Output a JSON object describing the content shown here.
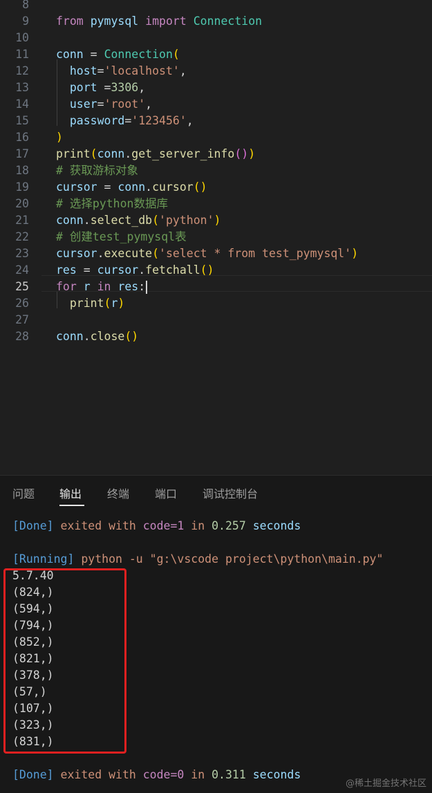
{
  "editor": {
    "lines": [
      {
        "num": "8",
        "segs": []
      },
      {
        "num": "9",
        "segs": [
          [
            "kw",
            "from"
          ],
          [
            "op",
            " "
          ],
          [
            "var",
            "pymysql"
          ],
          [
            "op",
            " "
          ],
          [
            "kw",
            "import"
          ],
          [
            "op",
            " "
          ],
          [
            "cls",
            "Connection"
          ]
        ]
      },
      {
        "num": "10",
        "segs": []
      },
      {
        "num": "11",
        "segs": [
          [
            "var",
            "conn"
          ],
          [
            "op",
            " = "
          ],
          [
            "cls",
            "Connection"
          ],
          [
            "p1",
            "("
          ]
        ]
      },
      {
        "num": "12",
        "segs": [
          [
            "op",
            "  "
          ],
          [
            "var",
            "host"
          ],
          [
            "op",
            "="
          ],
          [
            "str",
            "'localhost'"
          ],
          [
            "op",
            ","
          ]
        ]
      },
      {
        "num": "13",
        "segs": [
          [
            "op",
            "  "
          ],
          [
            "var",
            "port"
          ],
          [
            "op",
            " ="
          ],
          [
            "num",
            "3306"
          ],
          [
            "op",
            ","
          ]
        ]
      },
      {
        "num": "14",
        "segs": [
          [
            "op",
            "  "
          ],
          [
            "var",
            "user"
          ],
          [
            "op",
            "="
          ],
          [
            "str",
            "'root'"
          ],
          [
            "op",
            ","
          ]
        ]
      },
      {
        "num": "15",
        "segs": [
          [
            "op",
            "  "
          ],
          [
            "var",
            "password"
          ],
          [
            "op",
            "="
          ],
          [
            "str",
            "'123456'"
          ],
          [
            "op",
            ","
          ]
        ]
      },
      {
        "num": "16",
        "segs": [
          [
            "p1",
            ")"
          ]
        ]
      },
      {
        "num": "17",
        "segs": [
          [
            "fn",
            "print"
          ],
          [
            "p1",
            "("
          ],
          [
            "var",
            "conn"
          ],
          [
            "op",
            "."
          ],
          [
            "fn",
            "get_server_info"
          ],
          [
            "p2",
            "()"
          ],
          [
            "p1",
            ")"
          ]
        ]
      },
      {
        "num": "18",
        "segs": [
          [
            "cmt",
            "# 获取游标对象"
          ]
        ]
      },
      {
        "num": "19",
        "segs": [
          [
            "var",
            "cursor"
          ],
          [
            "op",
            " = "
          ],
          [
            "var",
            "conn"
          ],
          [
            "op",
            "."
          ],
          [
            "fn",
            "cursor"
          ],
          [
            "p1",
            "()"
          ]
        ]
      },
      {
        "num": "20",
        "segs": [
          [
            "cmt",
            "# 选择python数据库"
          ]
        ]
      },
      {
        "num": "21",
        "segs": [
          [
            "var",
            "conn"
          ],
          [
            "op",
            "."
          ],
          [
            "fn",
            "select_db"
          ],
          [
            "p1",
            "("
          ],
          [
            "str",
            "'python'"
          ],
          [
            "p1",
            ")"
          ]
        ]
      },
      {
        "num": "22",
        "segs": [
          [
            "cmt",
            "# 创建test_pymysql表"
          ]
        ]
      },
      {
        "num": "23",
        "segs": [
          [
            "var",
            "cursor"
          ],
          [
            "op",
            "."
          ],
          [
            "fn",
            "execute"
          ],
          [
            "p1",
            "("
          ],
          [
            "str",
            "'select * from test_pymysql'"
          ],
          [
            "p1",
            ")"
          ]
        ]
      },
      {
        "num": "24",
        "segs": [
          [
            "var",
            "res"
          ],
          [
            "op",
            " = "
          ],
          [
            "var",
            "cursor"
          ],
          [
            "op",
            "."
          ],
          [
            "fn",
            "fetchall"
          ],
          [
            "p1",
            "()"
          ]
        ]
      },
      {
        "num": "25",
        "segs": [
          [
            "ctl",
            "for"
          ],
          [
            "op",
            " "
          ],
          [
            "var",
            "r"
          ],
          [
            "op",
            " "
          ],
          [
            "ctl",
            "in"
          ],
          [
            "op",
            " "
          ],
          [
            "var",
            "res"
          ],
          [
            "op",
            ":"
          ]
        ],
        "active": true
      },
      {
        "num": "26",
        "segs": [
          [
            "op",
            "  "
          ],
          [
            "fn",
            "print"
          ],
          [
            "p1",
            "("
          ],
          [
            "var",
            "r"
          ],
          [
            "p1",
            ")"
          ]
        ]
      },
      {
        "num": "27",
        "segs": []
      },
      {
        "num": "28",
        "segs": [
          [
            "var",
            "conn"
          ],
          [
            "op",
            "."
          ],
          [
            "fn",
            "close"
          ],
          [
            "p1",
            "()"
          ]
        ]
      }
    ]
  },
  "panel": {
    "tabs": [
      "问题",
      "输出",
      "终端",
      "端口",
      "调试控制台"
    ],
    "active_tab": "输出",
    "output": {
      "done1": {
        "status": "[Done]",
        "t1": " exited with ",
        "code": "code=1",
        "t2": " in ",
        "num": "0.257",
        "secs": " seconds"
      },
      "running": {
        "status": "[Running]",
        "cmd": " python -u \"g:\\vscode project\\python\\main.py\""
      },
      "results": [
        "5.7.40",
        "(824,)",
        "(594,)",
        "(794,)",
        "(852,)",
        "(821,)",
        "(378,)",
        "(57,)",
        "(107,)",
        "(323,)",
        "(831,)"
      ],
      "done2": {
        "status": "[Done]",
        "t1": " exited with ",
        "code": "code=0",
        "t2": " in ",
        "num": "0.311",
        "secs": " seconds"
      }
    }
  },
  "watermark": "@稀土掘金技术社区"
}
